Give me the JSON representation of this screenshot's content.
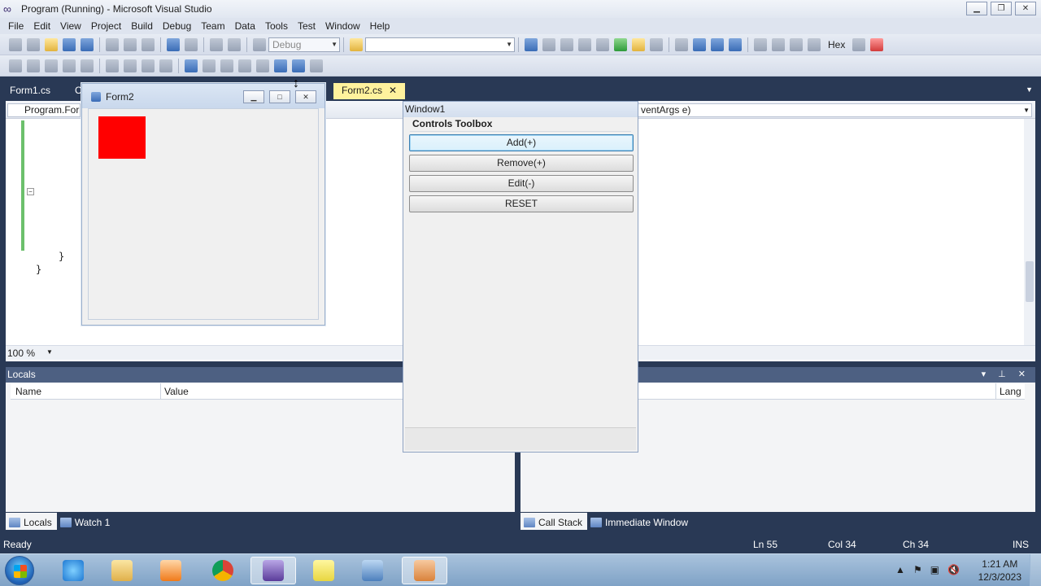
{
  "window": {
    "title": "Program (Running) - Microsoft Visual Studio",
    "minimize": "▁",
    "restore": "❐",
    "close": "✕"
  },
  "menu": [
    "File",
    "Edit",
    "View",
    "Project",
    "Build",
    "Debug",
    "Team",
    "Data",
    "Tools",
    "Test",
    "Window",
    "Help"
  ],
  "toolbar": {
    "config": "Debug",
    "hex_label": "Hex"
  },
  "tabs": {
    "tab1": "Form1.cs",
    "tab2": "C",
    "tab3": "Form2.cs",
    "tab3_close": "✕"
  },
  "editor": {
    "nav_left": "Program.Form",
    "nav_right": "ventArgs e)",
    "brace1": "}",
    "brace2": "}",
    "collapse": "−",
    "zoom": "100 %"
  },
  "locals": {
    "title": "Locals",
    "col_name": "Name",
    "col_value": "Value"
  },
  "callstack": {
    "col_lang": "Lang"
  },
  "bottom_tabs_left": {
    "locals": "Locals",
    "watch": "Watch 1"
  },
  "bottom_tabs_right": {
    "callstack": "Call Stack",
    "immediate": "Immediate Window"
  },
  "status": {
    "ready": "Ready",
    "ln": "Ln 55",
    "col": "Col 34",
    "ch": "Ch 34",
    "ins": "INS"
  },
  "form2": {
    "title": "Form2"
  },
  "window1": {
    "title": "Window1",
    "header": "Controls Toolbox",
    "buttons": {
      "add": "Add(+)",
      "remove": "Remove(+)",
      "edit": "Edit(-)",
      "reset": "RESET"
    }
  },
  "taskbar": {
    "time": "1:21 AM",
    "date": "12/3/2023"
  },
  "colors": {
    "red_square": "#ff0000",
    "active_tab": "#fff29d",
    "chrome": "#293955"
  }
}
